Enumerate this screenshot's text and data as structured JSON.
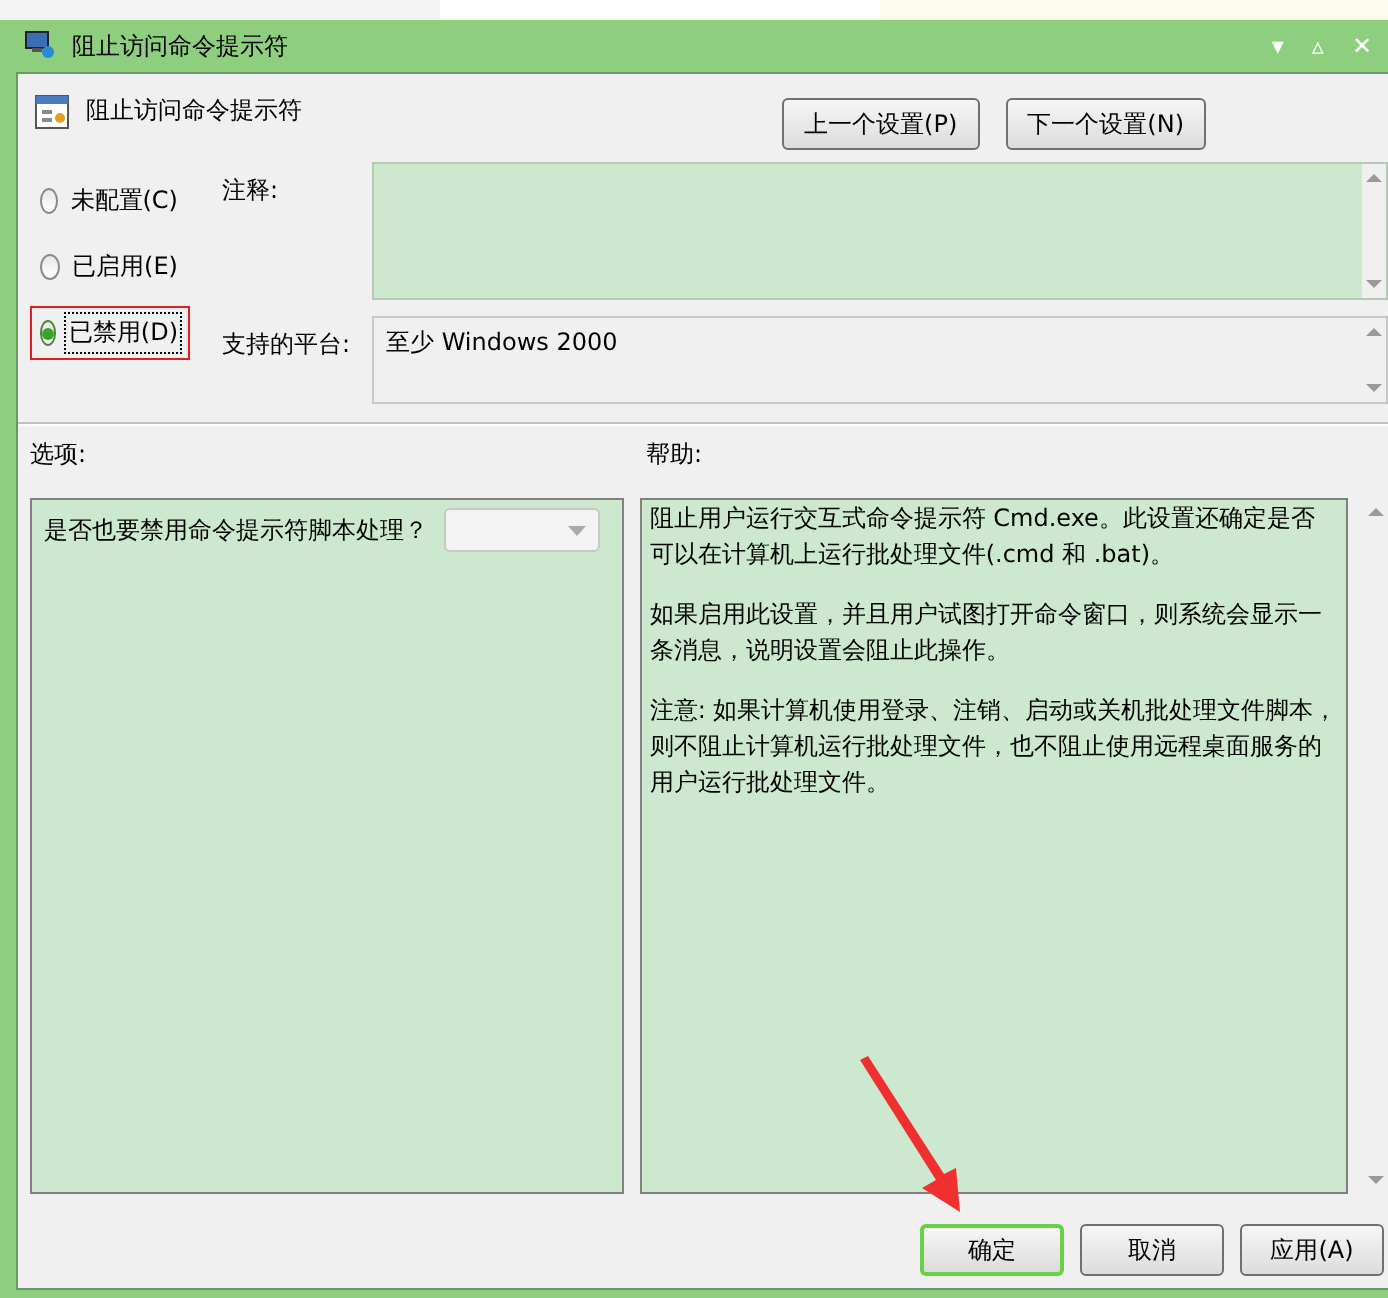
{
  "window": {
    "title": "阻止访问命令提示符",
    "controls": [
      "▾",
      "▵",
      "✕"
    ]
  },
  "header": {
    "title": "阻止访问命令提示符",
    "buttons": [
      {
        "label": "上一个设置(P)"
      },
      {
        "label": "下一个设置(N)"
      }
    ]
  },
  "states": [
    {
      "label": "未配置(C)",
      "selected": false,
      "highlighted": false
    },
    {
      "label": "已启用(E)",
      "selected": false,
      "highlighted": false
    },
    {
      "label": "已禁用(D)",
      "selected": true,
      "highlighted": true
    }
  ],
  "comment": {
    "label": "注释:"
  },
  "platform": {
    "label": "支持的平台:",
    "value": "至少 Windows 2000"
  },
  "options": {
    "label": "选项:",
    "question": "是否也要禁用命令提示符脚本处理？"
  },
  "help": {
    "label": "帮助:",
    "paragraphs": [
      "阻止用户运行交互式命令提示符 Cmd.exe。此设置还确定是否可以在计算机上运行批处理文件(.cmd 和 .bat)。",
      "如果启用此设置，并且用户试图打开命令窗口，则系统会显示一条消息，说明设置会阻止此操作。",
      "注意: 如果计算机使用登录、注销、启动或关机批处理文件脚本，则不阻止计算机运行批处理文件，也不阻止使用远程桌面服务的用户运行批处理文件。"
    ]
  },
  "footer": {
    "buttons": [
      {
        "label": "确定",
        "focused": true
      },
      {
        "label": "取消",
        "focused": false
      },
      {
        "label": "应用(A)",
        "focused": false
      }
    ]
  },
  "annotation": {
    "arrow": true
  }
}
